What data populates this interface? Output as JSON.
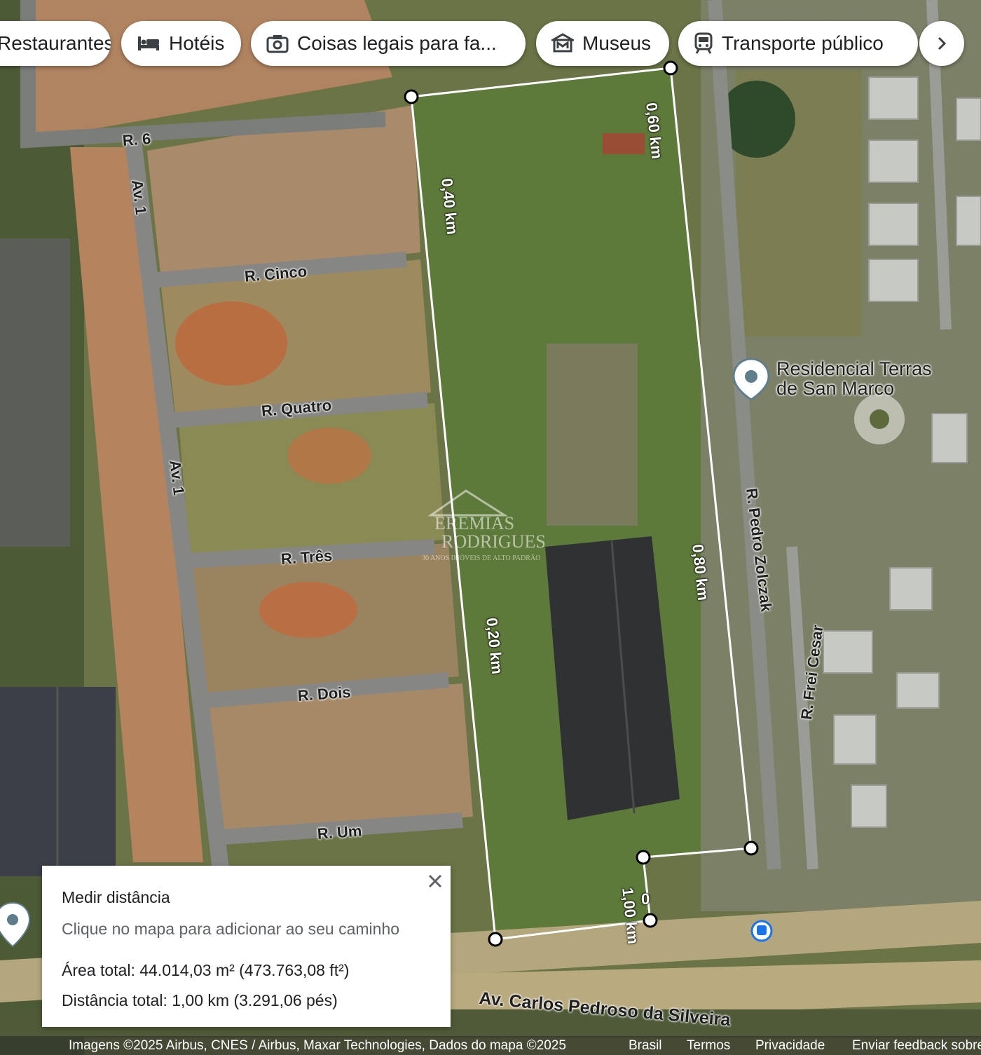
{
  "chips": [
    {
      "label": "Restaurantes",
      "icon": "fork-knife-icon"
    },
    {
      "label": "Hotéis",
      "icon": "bed-icon"
    },
    {
      "label": "Coisas legais para fa...",
      "icon": "camera-icon"
    },
    {
      "label": "Museus",
      "icon": "museum-icon"
    },
    {
      "label": "Transporte público",
      "icon": "train-icon"
    }
  ],
  "chips_next_icon": "chevron-right-icon",
  "roads": {
    "r6": "R. 6",
    "av1_top": "Av. 1",
    "av1_mid": "Av. 1",
    "cinco": "R. Cinco",
    "quatro": "R. Quatro",
    "tres": "R. Três",
    "dois": "R. Dois",
    "um": "R. Um",
    "pedro": "R. Pedro Zolczak",
    "frei": "R. Frei Cesar",
    "avenida": "Av. Carlos Pedroso da Silveira"
  },
  "poi": {
    "name_line1": "Residencial Terras",
    "name_line2": "de San Marco",
    "icon": "place-pin-icon"
  },
  "measurements": {
    "top": "0,60 km",
    "left_upper": "0,40 km",
    "left_lower": "0,20 km",
    "right": "0,80 km",
    "bottom": "1,00 km",
    "small": "0"
  },
  "watermark": {
    "line1": "EREMIAS",
    "line2": "RODRIGUES",
    "line3": "30 ANOS IMÓVEIS DE ALTO PADRÃO"
  },
  "panel": {
    "title": "Medir distância",
    "hint": "Clique no mapa para adicionar ao seu caminho",
    "area": "Área total: 44.014,03 m² (473.763,08 ft²)",
    "distance": "Distância total: 1,00 km (3.291,06 pés)",
    "close_icon": "close-icon"
  },
  "footer": {
    "attribution": "Imagens ©2025 Airbus, CNES / Airbus, Maxar Technologies, Dados do mapa ©2025",
    "country": "Brasil",
    "terms": "Termos",
    "privacy": "Privacidade",
    "feedback": "Enviar feedback sobre o produto"
  },
  "colors": {
    "measure_line": "#ffffff",
    "chip_bg": "#ffffff",
    "panel_bg": "#ffffff"
  }
}
